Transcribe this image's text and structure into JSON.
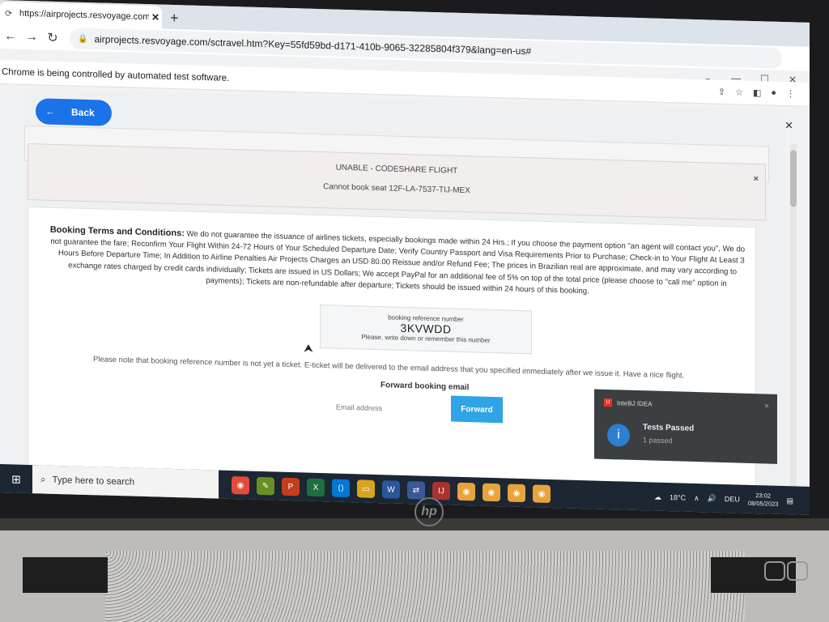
{
  "browser": {
    "tab_title": "https://airprojects.resvoyage.com",
    "tab_close": "✕",
    "new_tab": "+",
    "url": "airprojects.resvoyage.com/sctravel.htm?Key=55fd59bd-d171-410b-9065-32285804f379&lang=en-us#",
    "infobar_text": "Chrome is being controlled by automated test software.",
    "infobar_close": "✕",
    "window_minimize": "⌄",
    "window_min": "—",
    "window_max": "☐",
    "window_close": "✕"
  },
  "page": {
    "back_label": "Back",
    "back_arrow": "←",
    "alert": {
      "title": "UNABLE - CODESHARE FLIGHT",
      "message": "Cannot book seat 12F-LA-7537-TIJ-MEX",
      "close": "×"
    },
    "terms": {
      "heading": "Booking Terms and Conditions:",
      "body": "We do not guarantee the issuance of airlines tickets, especially bookings made within 24 Hrs.; If you choose the payment option \"an agent will contact you\", We do not guarantee the fare; Reconfirm Your Flight Within 24-72 Hours of Your Scheduled Departure Date; Verify Country Passport and Visa Requirements Prior to Purchase; Check-in to Your Flight At Least 3 Hours Before Departure Time; In Addition to Airline Penalties Air Projects Charges an USD 80.00 Reissue and/or Refund Fee; The prices in Brazilian real are approximate, and may vary according to exchange rates charged by credit cards individually; Tickets are issued in US Dollars; We accept PayPal for an additional fee of 5% on top of the total price (please choose to \"call me\" option in payments); Tickets are non-refundable after departure; Tickets should be issued within 24 hours of this booking."
    },
    "booking_ref": {
      "label": "booking reference number",
      "number": "3KVWDD",
      "hint": "Please, write down or remember this number"
    },
    "note": "Please note that booking reference number is not yet a ticket. E-ticket will be delivered to the email address that you specified immediately after we issue it. Have a nice flight.",
    "forward_title": "Forward booking email",
    "email_placeholder": "Email address",
    "forward_button": "Forward"
  },
  "notification": {
    "app": "IntelliJ IDEA",
    "title": "Tests Passed",
    "subtitle": "1 passed",
    "close": "×"
  },
  "taskbar": {
    "search_placeholder": "Type here to search",
    "weather": "18°C",
    "language": "DEU",
    "time": "23:02",
    "date": "08/05/2023"
  },
  "colors": {
    "accent": "#1a73e8",
    "forward_button": "#2fa4e7",
    "toast_bg": "#3c3f41"
  }
}
